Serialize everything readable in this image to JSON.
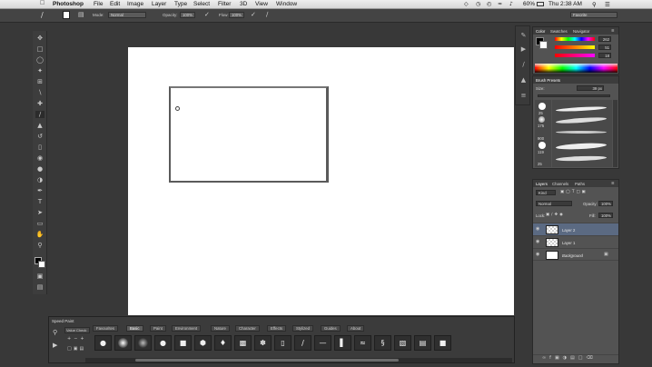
{
  "menubar": {
    "app": "Photoshop",
    "items": [
      "File",
      "Edit",
      "Image",
      "Layer",
      "Type",
      "Select",
      "Filter",
      "3D",
      "View",
      "Window"
    ],
    "battery": "60%",
    "clock": "Thu 2:38 AM"
  },
  "options": {
    "mode_label": "Mode:",
    "mode_value": "Normal",
    "opacity_label": "Opacity:",
    "opacity_value": "100%",
    "flow_label": "Flow:",
    "flow_value": "100%",
    "workspace": "Favorite"
  },
  "color_panel": {
    "tabs": [
      "Color",
      "Swatches",
      "Navigator"
    ],
    "r": "262",
    "g": "51",
    "b": "18"
  },
  "brush_presets": {
    "title": "Brush Presets",
    "size_label": "Size:",
    "size_value": "39 px",
    "sizes": [
      "25",
      "175",
      "900",
      "119",
      "25"
    ]
  },
  "layers_panel": {
    "tabs": [
      "Layers",
      "Channels",
      "Paths"
    ],
    "kind": "Kind",
    "blend": "Normal",
    "opacity_label": "Opacity:",
    "opacity_value": "100%",
    "lock_label": "Lock:",
    "fill_label": "Fill:",
    "fill_value": "100%",
    "layers": [
      {
        "name": "Layer 2"
      },
      {
        "name": "Layer 1"
      },
      {
        "name": "Background"
      }
    ]
  },
  "speed_paint": {
    "title": "Speed Paint",
    "value_check": "Value Check",
    "tabs": [
      "Favourites",
      "Basic",
      "Paint",
      "Environment",
      "Nature",
      "Character",
      "Effects",
      "Stylized",
      "Guides",
      "About"
    ],
    "active_tab": "Basic"
  },
  "colors": {
    "app_bg": "#383838",
    "panel_bg": "#535353",
    "accent": "#4f87d6"
  }
}
